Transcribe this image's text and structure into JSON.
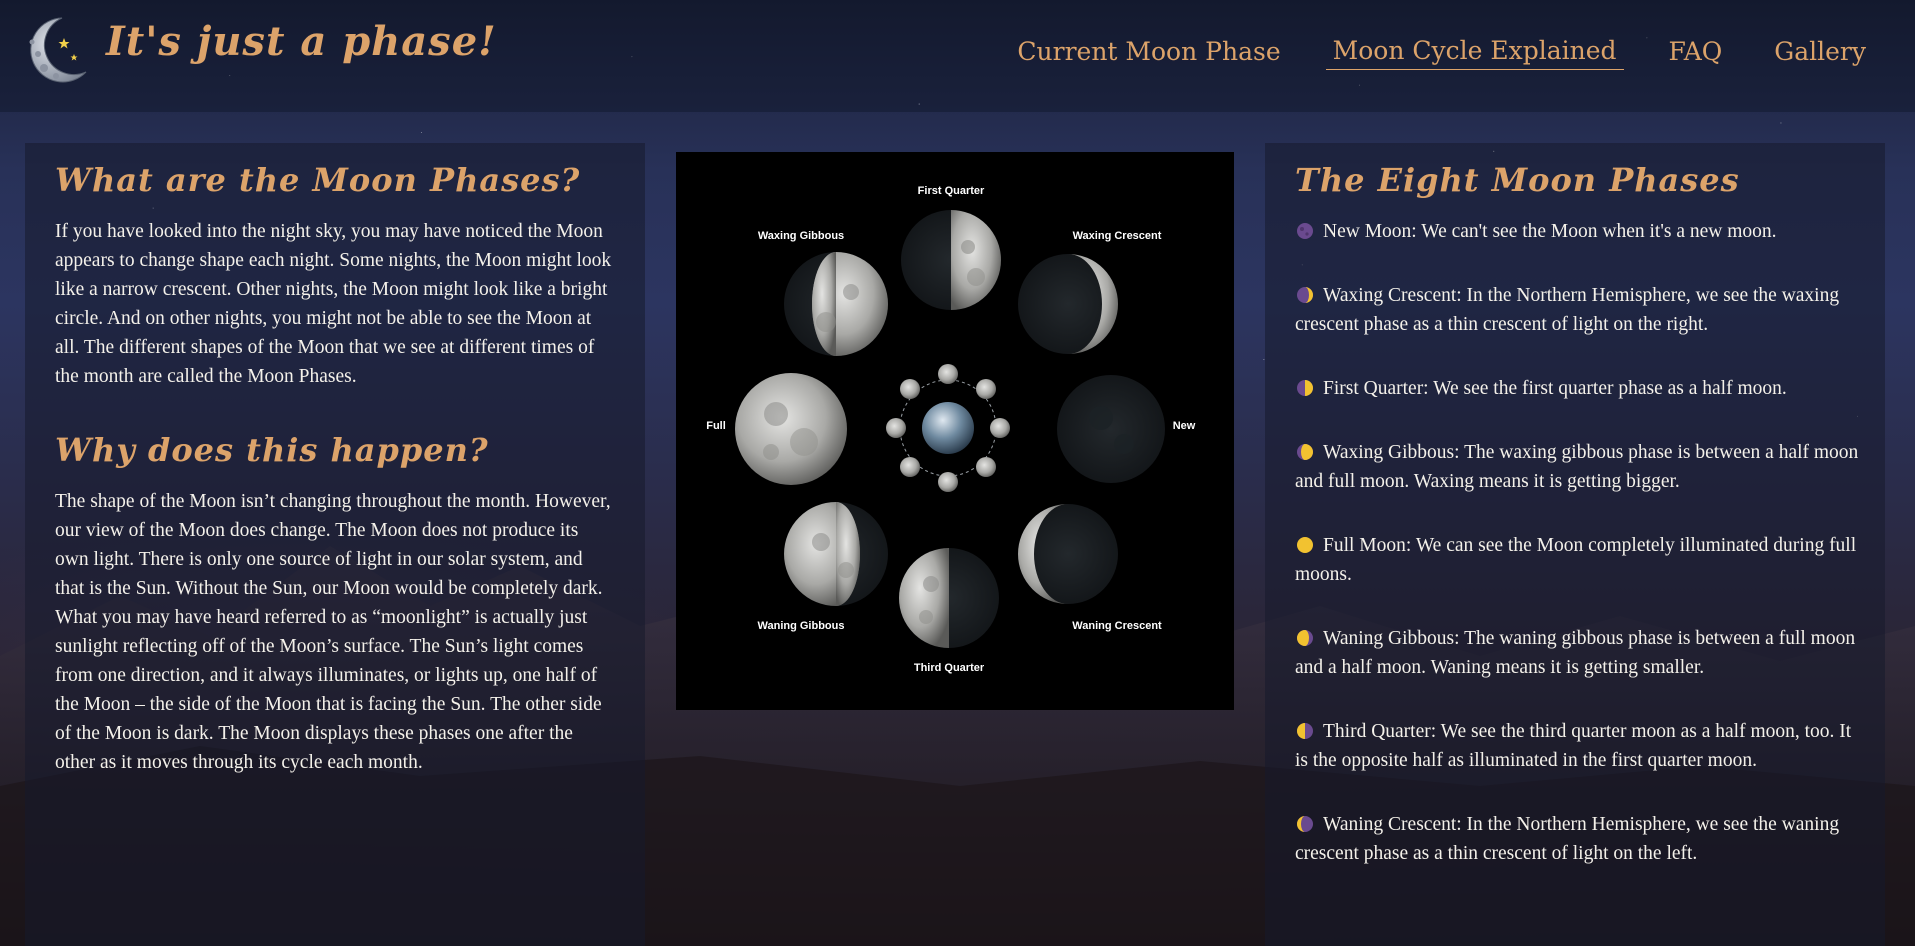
{
  "header": {
    "title": "It's just a phase!",
    "logo_icon": "crescent-moon-stars-icon",
    "nav": [
      {
        "label": "Current Moon Phase",
        "active": false
      },
      {
        "label": "Moon Cycle Explained",
        "active": true
      },
      {
        "label": "FAQ",
        "active": false
      },
      {
        "label": "Gallery",
        "active": false
      }
    ]
  },
  "left": {
    "heading1": "What are the Moon Phases?",
    "para1": "If you have looked into the night sky, you may have noticed the Moon appears to change shape each night. Some nights, the Moon might look like a narrow crescent. Other nights, the Moon might look like a bright circle. And on other nights, you might not be able to see the Moon at all. The different shapes of the Moon that we see at different times of the month are called the Moon Phases.",
    "heading2": "Why does this happen?",
    "para2": "The shape of the Moon isn’t changing throughout the month. However, our view of the Moon does change. The Moon does not produce its own light. There is only one source of light in our solar system, and that is the Sun. Without the Sun, our Moon would be completely dark. What you may have heard referred to as “moonlight” is actually just sunlight reflecting off of the Moon’s surface. The Sun’s light comes from one direction, and it always illuminates, or lights up, one half of the Moon – the side of the Moon that is facing the Sun. The other side of the Moon is dark. The Moon displays these phases one after the other as it moves through its cycle each month."
  },
  "figure": {
    "labels": {
      "first_quarter": "First Quarter",
      "waxing_gibbous": "Waxing Gibbous",
      "waxing_crescent": "Waxing Crescent",
      "full": "Full",
      "new": "New",
      "waning_gibbous": "Waning Gibbous",
      "waning_crescent": "Waning Crescent",
      "third_quarter": "Third Quarter"
    }
  },
  "right": {
    "heading": "The Eight Moon Phases",
    "items": [
      {
        "icon": "new-moon-icon",
        "text": "New Moon: We can't see the Moon when it's a new moon."
      },
      {
        "icon": "waxing-crescent-icon",
        "text": "Waxing Crescent: In the Northern Hemisphere, we see the waxing crescent phase as a thin crescent of light on the right."
      },
      {
        "icon": "first-quarter-icon",
        "text": "First Quarter: We see the first quarter phase as a half moon."
      },
      {
        "icon": "waxing-gibbous-icon",
        "text": "Waxing Gibbous: The waxing gibbous phase is between a half moon and full moon. Waxing means it is getting bigger."
      },
      {
        "icon": "full-moon-icon",
        "text": "Full Moon: We can see the Moon completely illuminated during full moons."
      },
      {
        "icon": "waning-gibbous-icon",
        "text": "Waning Gibbous: The waning gibbous phase is between a full moon and a half moon. Waning means it is getting smaller."
      },
      {
        "icon": "third-quarter-icon",
        "text": "Third Quarter: We see the third quarter moon as a half moon, too. It is the opposite half as illuminated in the first quarter moon."
      },
      {
        "icon": "waning-crescent-icon",
        "text": "Waning Crescent: In the Northern Hemisphere, we see the waning crescent phase as a thin crescent of light on the left."
      }
    ]
  },
  "colors": {
    "accent": "#dca36a",
    "text": "#f4f1ea",
    "panel": "#161a2c",
    "moon_yellow": "#f2c230",
    "moon_purple": "#7b5aa6"
  }
}
